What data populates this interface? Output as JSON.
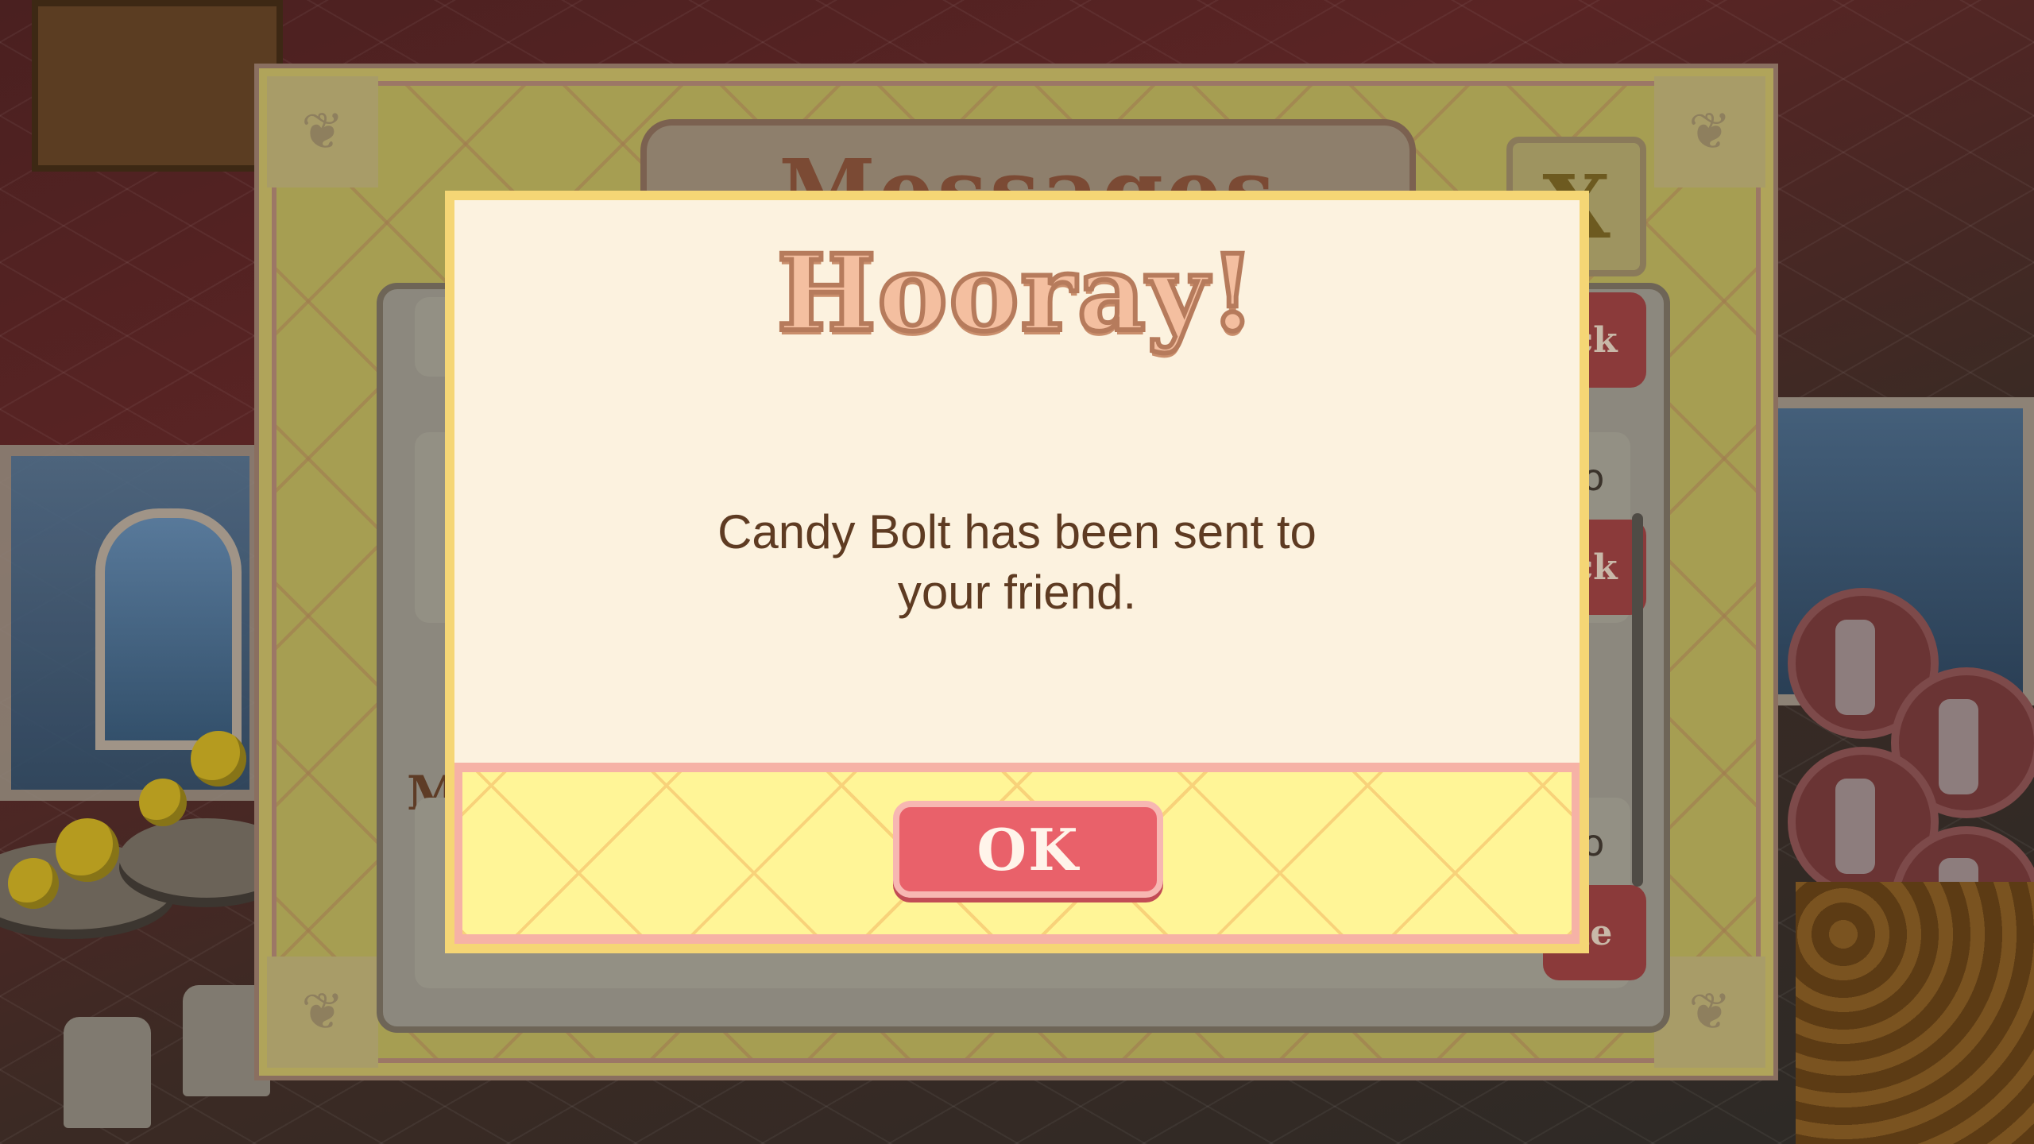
{
  "messages_panel": {
    "title": "Messages",
    "close_label": "X",
    "rows": [
      {
        "age": "",
        "button_label": "ck"
      },
      {
        "age": "go",
        "button_label": "ck"
      },
      {
        "age": "go",
        "button_label": "le"
      }
    ],
    "section_label": "M"
  },
  "dialog": {
    "title": "Hooray!",
    "message": "Candy Bolt has been sent to your friend.",
    "ok_label": "OK"
  },
  "colors": {
    "dialog_bg": "#fcf2df",
    "dialog_border": "#f5d675",
    "footer_bg": "#fff597",
    "footer_border": "#f6b2a6",
    "ok_button": "#e9616a",
    "title_fill": "#f4bfa0",
    "message_text": "#5e3b22"
  }
}
